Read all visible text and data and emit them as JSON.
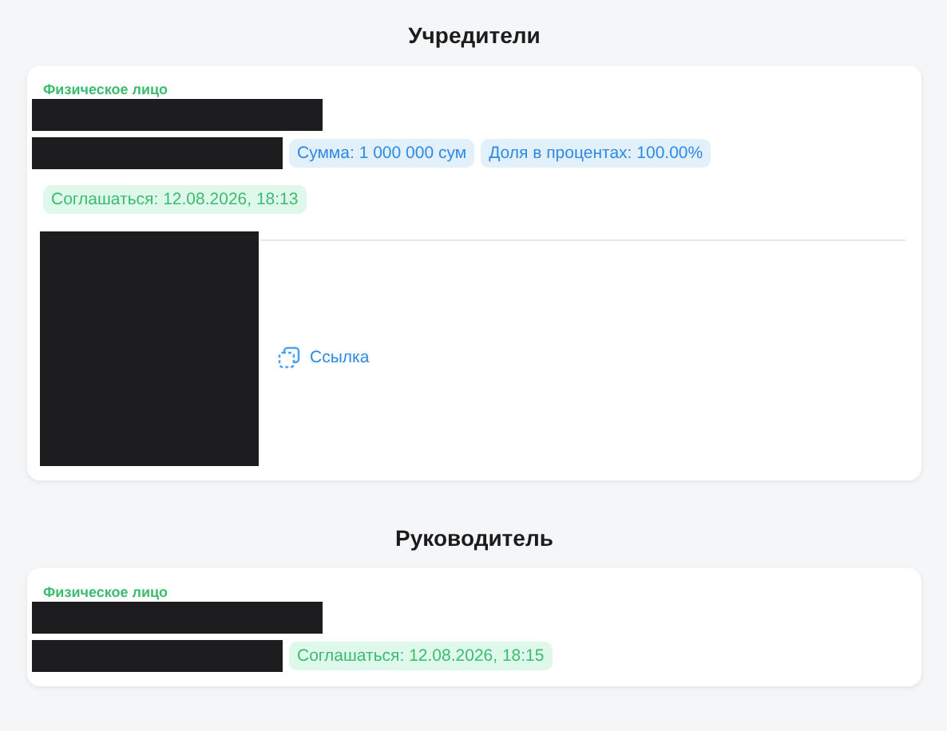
{
  "sections": [
    {
      "title": "Учредители",
      "person_type": "Физическое лицо",
      "badges": [
        {
          "kind": "info",
          "text": "Сумма: 1 000 000 сум"
        },
        {
          "kind": "info",
          "text": "Доля в процентах: 100.00%"
        },
        {
          "kind": "success",
          "text": "Соглашаться: 12.08.2026, 18:13"
        }
      ],
      "document": {
        "link": "Ссылка"
      }
    },
    {
      "title": "Руководитель",
      "person_type": "Физическое лицо",
      "badges": [
        {
          "kind": "success",
          "text": "Соглашаться: 12.08.2026, 18:15"
        }
      ]
    }
  ]
}
